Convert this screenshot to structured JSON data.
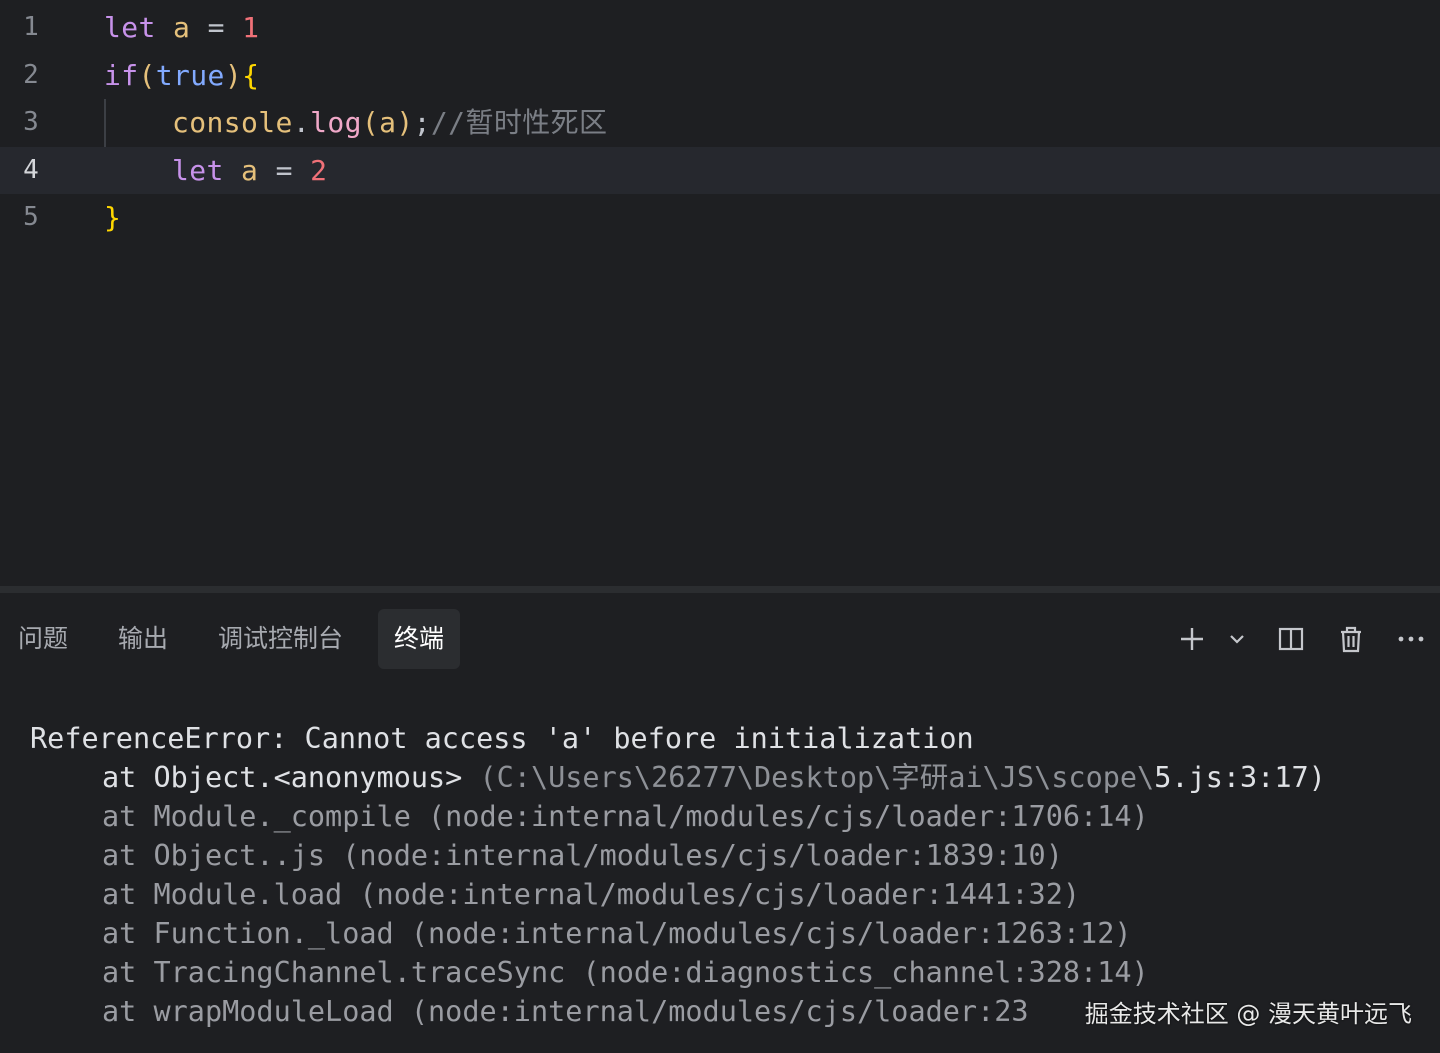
{
  "editor": {
    "lines": [
      {
        "number": "1",
        "tokens": {
          "kw": "let",
          "var": "a",
          "op": "=",
          "num": "1"
        }
      },
      {
        "number": "2",
        "tokens": {
          "kw": "if",
          "open_paren": "(",
          "bool": "true",
          "close_paren": ")",
          "brace": "{"
        }
      },
      {
        "number": "3",
        "tokens": {
          "obj": "console",
          "dot": ".",
          "fn": "log",
          "open_paren": "(",
          "arg": "a",
          "close_paren": ")",
          "semi": ";",
          "comment_slashes": "//",
          "comment_text": "暂时性死区"
        }
      },
      {
        "number": "4",
        "tokens": {
          "kw": "let",
          "var": "a",
          "op": "=",
          "num": "2"
        }
      },
      {
        "number": "5",
        "tokens": {
          "brace": "}"
        }
      }
    ],
    "current_line": "4"
  },
  "panel": {
    "tabs": [
      {
        "label": "问题"
      },
      {
        "label": "输出"
      },
      {
        "label": "调试控制台"
      },
      {
        "label": "终端"
      }
    ],
    "active_tab": "终端",
    "actions": [
      {
        "icon": "plus-icon"
      },
      {
        "icon": "chevron-down-icon"
      },
      {
        "icon": "split-icon"
      },
      {
        "icon": "trash-icon"
      },
      {
        "icon": "more-icon"
      }
    ]
  },
  "terminal": {
    "error": "ReferenceError: Cannot access 'a' before initialization",
    "stack": [
      {
        "fn": "at Object.<anonymous>",
        "loc_pre": " (C:\\Users\\26277\\Desktop\\",
        "loc_cjk": "字研",
        "loc_mid": "ai\\JS\\scope\\",
        "loc_post": "5.js:3:17)"
      },
      {
        "fn": "at Module._compile",
        "loc": " (node:internal/modules/cjs/loader:1706:14)"
      },
      {
        "fn": "at Object..js",
        "loc": " (node:internal/modules/cjs/loader:1839:10)"
      },
      {
        "fn": "at Module.load",
        "loc": " (node:internal/modules/cjs/loader:1441:32)"
      },
      {
        "fn": "at Function._load",
        "loc": " (node:internal/modules/cjs/loader:1263:12)"
      },
      {
        "fn": "at TracingChannel.traceSync",
        "loc": " (node:diagnostics_channel:328:14)"
      },
      {
        "fn": "at wrapModuleLoad",
        "loc": " (node:internal/modules/cjs/loader:23"
      }
    ]
  },
  "watermark": "掘金技术社区 @ 漫天黄叶远飞"
}
